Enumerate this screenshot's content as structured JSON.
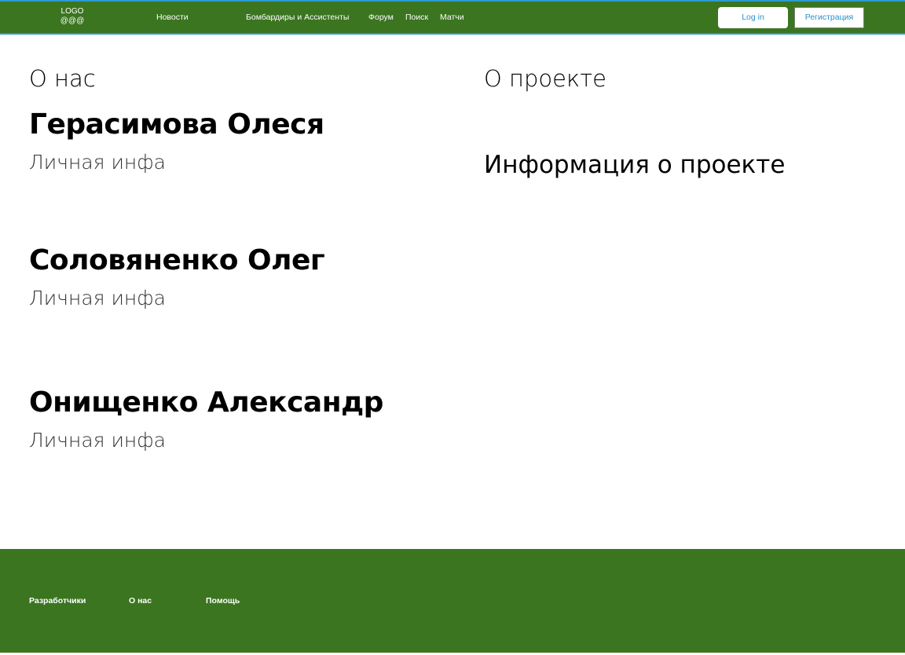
{
  "header": {
    "logo_line1": "LOGO",
    "logo_line2": "@@@",
    "nav": {
      "news": "Новости",
      "scorers": "Бомбардиры и Ассистенты",
      "forum": "Форум",
      "search": "Поиск",
      "matches": "Матчи"
    },
    "login_label": "Log in",
    "register_label": "Регистрация"
  },
  "main": {
    "about_title": "О нас",
    "project_title": "О проекте",
    "project_info": "Информация о проекте",
    "people": [
      {
        "name": "Герасимова Олеся",
        "info": "Личная инфа"
      },
      {
        "name": "Соловяненко Олег",
        "info": "Личная инфа"
      },
      {
        "name": "Онищенко Александр",
        "info": "Личная инфа"
      }
    ]
  },
  "footer": {
    "developers": "Разработчики",
    "about": "О нас",
    "help": "Помощь"
  },
  "colors": {
    "brand_green": "#3b7520",
    "accent_blue": "#2b9ad6"
  }
}
